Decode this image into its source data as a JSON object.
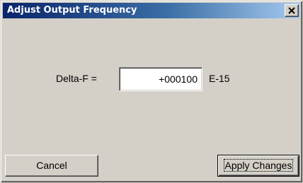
{
  "window": {
    "title": "Adjust Output Frequency"
  },
  "titlebar": {
    "close_icon": "close-x-icon"
  },
  "form": {
    "delta_label": "Delta-F =",
    "delta_value": "+000100",
    "unit_label": "E-15"
  },
  "buttons": {
    "cancel_label": "Cancel",
    "apply_label": "Apply Changes"
  },
  "colors": {
    "titlebar_start": "#0a246a",
    "titlebar_end": "#a6caf0",
    "face": "#d4d0c8"
  }
}
